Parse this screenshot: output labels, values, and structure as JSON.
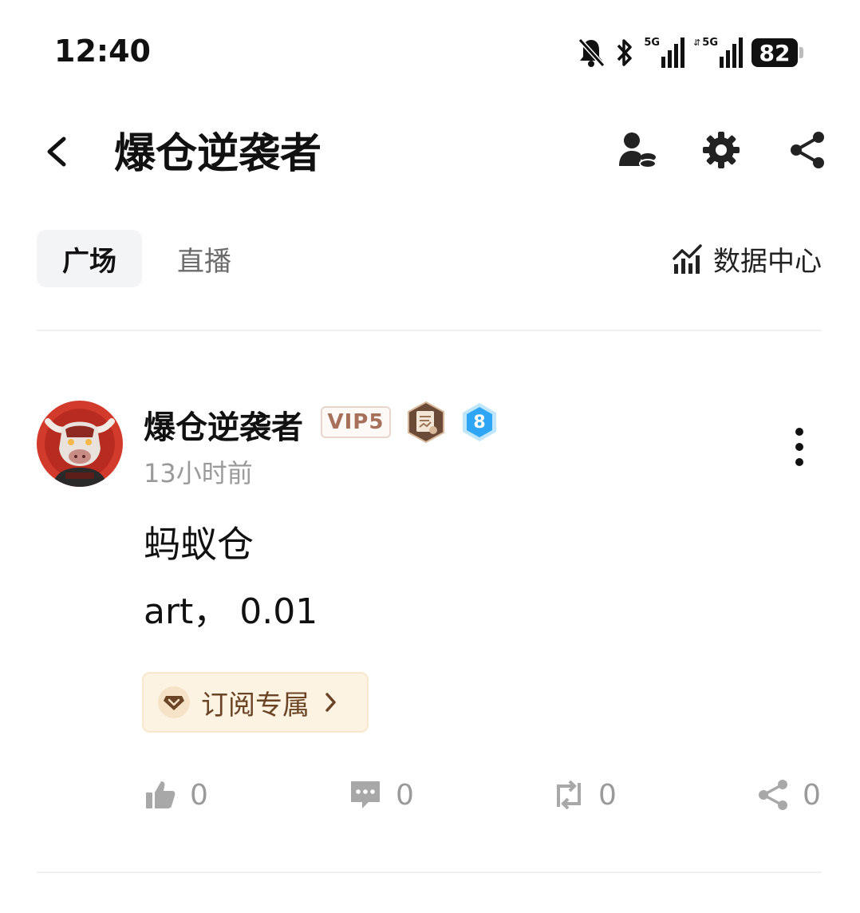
{
  "status_bar": {
    "time": "12:40",
    "signal1_label": "5G",
    "signal2_label": "5G",
    "battery": "82"
  },
  "header": {
    "title": "爆仓逆袭者",
    "icons": [
      "back-icon",
      "user-coin-icon",
      "gear-icon",
      "share-icon"
    ]
  },
  "tabs": [
    {
      "label": "广场",
      "active": true
    },
    {
      "label": "直播",
      "active": false
    }
  ],
  "data_center": {
    "label": "数据中心"
  },
  "post": {
    "author": "爆仓逆袭者",
    "vip_badge": "VIP5",
    "level_badge": "8",
    "time": "13小时前",
    "lines": [
      "蚂蚁仓",
      "art， 0.01"
    ],
    "subscribe_label": "订阅专属",
    "actions": {
      "like": "0",
      "comment": "0",
      "repost": "0",
      "share": "0"
    }
  },
  "colors": {
    "accent_gold": "#6b4426",
    "subscribe_bg": "#fdf3e2",
    "muted_text": "#9a9a9a",
    "level_badge_blue": "#2ea6f5"
  }
}
